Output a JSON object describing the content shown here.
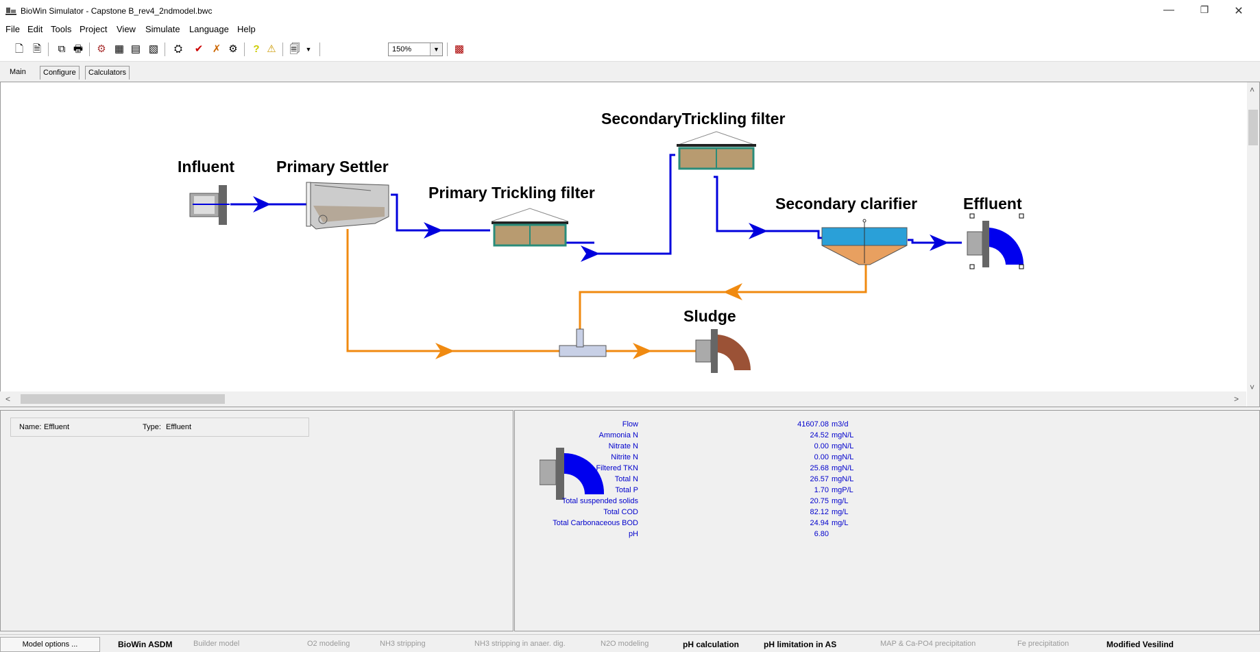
{
  "window": {
    "title": "BioWin Simulator - Capstone B_rev4_2ndmodel.bwc",
    "minimize_glyph": "—",
    "restore_glyph": "❐",
    "close_glyph": "✕"
  },
  "menu": [
    "File",
    "Edit",
    "Tools",
    "Project",
    "View",
    "Simulate",
    "Language",
    "Help"
  ],
  "toolbar": {
    "icons": [
      "new-file-icon",
      "open-file-icon",
      "copy-icon",
      "print-icon",
      "flowsheet-icon",
      "table-icon",
      "chart-icon",
      "album-icon",
      "valve-icon",
      "check-icon",
      "wrench-icon",
      "settings-icon",
      "help-icon",
      "warning-icon",
      "report-icon",
      "grid-icon"
    ],
    "zoom_value": "150%"
  },
  "tabs": [
    "Main",
    "Configure",
    "Calculators"
  ],
  "flowsheet": {
    "labels": {
      "influent": "Influent",
      "primary_settler": "Primary Settler",
      "primary_tf": "Primary Trickling filter",
      "secondary_tf": "SecondaryTrickling filter",
      "secondary_clarifier": "Secondary clarifier",
      "effluent": "Effluent",
      "sludge": "Sludge"
    },
    "colors": {
      "liquid_line": "#0000dd",
      "sludge_line": "#f08a10",
      "effluent_fill": "#0000ee",
      "sludge_fill": "#9b5236",
      "clarifier_water": "#2aa0d8",
      "clarifier_sludge": "#e8a060",
      "filter_media": "#b89b70",
      "filter_frame": "#2a8c7a"
    }
  },
  "details": {
    "name_label": "Name:",
    "name_value": "Effluent",
    "type_label": "Type:",
    "type_value": "Effluent"
  },
  "stats": [
    {
      "label": "Flow",
      "value": "41607.08",
      "unit": "m3/d"
    },
    {
      "label": "Ammonia N",
      "value": "24.52",
      "unit": "mgN/L"
    },
    {
      "label": "Nitrate N",
      "value": "0.00",
      "unit": "mgN/L"
    },
    {
      "label": "Nitrite N",
      "value": "0.00",
      "unit": "mgN/L"
    },
    {
      "label": "Filtered TKN",
      "value": "25.68",
      "unit": "mgN/L"
    },
    {
      "label": "Total N",
      "value": "26.57",
      "unit": "mgN/L"
    },
    {
      "label": "Total P",
      "value": "1.70",
      "unit": "mgP/L"
    },
    {
      "label": "Total suspended solids",
      "value": "20.75",
      "unit": "mg/L"
    },
    {
      "label": "Total COD",
      "value": "82.12",
      "unit": "mg/L"
    },
    {
      "label": "Total Carbonaceous BOD",
      "value": "24.94",
      "unit": "mg/L"
    },
    {
      "label": "pH",
      "value": "6.80",
      "unit": ""
    }
  ],
  "statusbar": {
    "model_options": "Model options ...",
    "model_name": "BioWin ASDM",
    "items": [
      "Builder model",
      "O2 modeling",
      "NH3 stripping",
      "NH3 stripping in anaer. dig.",
      "N2O modeling",
      "pH calculation",
      "pH limitation in AS",
      "MAP & Ca-PO4 precipitation",
      "Fe precipitation",
      "Modified Vesilind"
    ],
    "bold_items": [
      "pH calculation",
      "pH limitation in AS",
      "Modified Vesilind"
    ]
  }
}
